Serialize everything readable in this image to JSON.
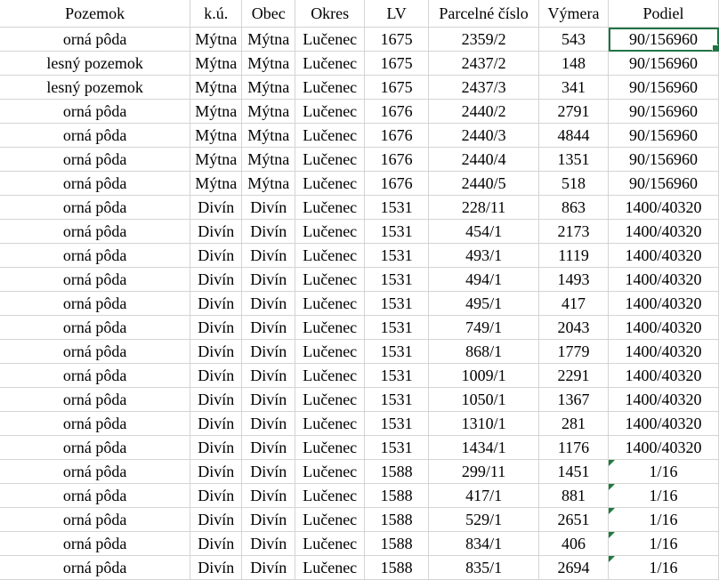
{
  "headers": [
    "Pozemok",
    "k.ú.",
    "Obec",
    "Okres",
    "LV",
    "Parcelné číslo",
    "Výmera",
    "Podiel"
  ],
  "rows": [
    [
      "orná pôda",
      "Mýtna",
      "Mýtna",
      "Lučenec",
      "1675",
      "2359/2",
      "543",
      "90/156960"
    ],
    [
      "lesný pozemok",
      "Mýtna",
      "Mýtna",
      "Lučenec",
      "1675",
      "2437/2",
      "148",
      "90/156960"
    ],
    [
      "lesný pozemok",
      "Mýtna",
      "Mýtna",
      "Lučenec",
      "1675",
      "2437/3",
      "341",
      "90/156960"
    ],
    [
      "orná pôda",
      "Mýtna",
      "Mýtna",
      "Lučenec",
      "1676",
      "2440/2",
      "2791",
      "90/156960"
    ],
    [
      "orná pôda",
      "Mýtna",
      "Mýtna",
      "Lučenec",
      "1676",
      "2440/3",
      "4844",
      "90/156960"
    ],
    [
      "orná pôda",
      "Mýtna",
      "Mýtna",
      "Lučenec",
      "1676",
      "2440/4",
      "1351",
      "90/156960"
    ],
    [
      "orná pôda",
      "Mýtna",
      "Mýtna",
      "Lučenec",
      "1676",
      "2440/5",
      "518",
      "90/156960"
    ],
    [
      "orná pôda",
      "Divín",
      "Divín",
      "Lučenec",
      "1531",
      "228/11",
      "863",
      "1400/40320"
    ],
    [
      "orná pôda",
      "Divín",
      "Divín",
      "Lučenec",
      "1531",
      "454/1",
      "2173",
      "1400/40320"
    ],
    [
      "orná pôda",
      "Divín",
      "Divín",
      "Lučenec",
      "1531",
      "493/1",
      "1119",
      "1400/40320"
    ],
    [
      "orná pôda",
      "Divín",
      "Divín",
      "Lučenec",
      "1531",
      "494/1",
      "1493",
      "1400/40320"
    ],
    [
      "orná pôda",
      "Divín",
      "Divín",
      "Lučenec",
      "1531",
      "495/1",
      "417",
      "1400/40320"
    ],
    [
      "orná pôda",
      "Divín",
      "Divín",
      "Lučenec",
      "1531",
      "749/1",
      "2043",
      "1400/40320"
    ],
    [
      "orná pôda",
      "Divín",
      "Divín",
      "Lučenec",
      "1531",
      "868/1",
      "1779",
      "1400/40320"
    ],
    [
      "orná pôda",
      "Divín",
      "Divín",
      "Lučenec",
      "1531",
      "1009/1",
      "2291",
      "1400/40320"
    ],
    [
      "orná pôda",
      "Divín",
      "Divín",
      "Lučenec",
      "1531",
      "1050/1",
      "1367",
      "1400/40320"
    ],
    [
      "orná pôda",
      "Divín",
      "Divín",
      "Lučenec",
      "1531",
      "1310/1",
      "281",
      "1400/40320"
    ],
    [
      "orná pôda",
      "Divín",
      "Divín",
      "Lučenec",
      "1531",
      "1434/1",
      "1176",
      "1400/40320"
    ],
    [
      "orná pôda",
      "Divín",
      "Divín",
      "Lučenec",
      "1588",
      "299/11",
      "1451",
      "1/16"
    ],
    [
      "orná pôda",
      "Divín",
      "Divín",
      "Lučenec",
      "1588",
      "417/1",
      "881",
      "1/16"
    ],
    [
      "orná pôda",
      "Divín",
      "Divín",
      "Lučenec",
      "1588",
      "529/1",
      "2651",
      "1/16"
    ],
    [
      "orná pôda",
      "Divín",
      "Divín",
      "Lučenec",
      "1588",
      "834/1",
      "406",
      "1/16"
    ],
    [
      "orná pôda",
      "Divín",
      "Divín",
      "Lučenec",
      "1588",
      "835/1",
      "2694",
      "1/16"
    ]
  ],
  "text_number_marker_rows": [
    18,
    19,
    20,
    21,
    22
  ],
  "selected_cell": {
    "row": 0,
    "col": 7
  },
  "colors": {
    "grid": "#d4d4d4",
    "selection": "#217346",
    "marker": "#1e7a3c"
  }
}
